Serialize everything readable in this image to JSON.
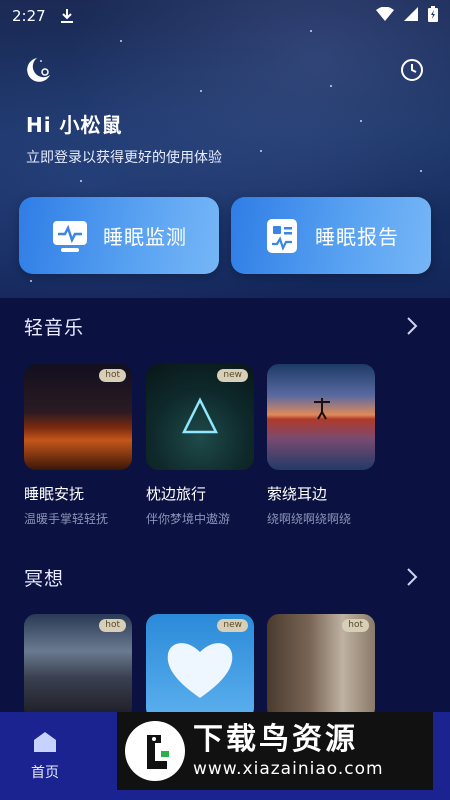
{
  "status_bar": {
    "time": "2:27"
  },
  "header": {
    "greeting": "Hi 小松鼠",
    "subtitle": "立即登录以获得更好的使用体验"
  },
  "actions": [
    {
      "label": "睡眠监测",
      "icon": "monitor-icon"
    },
    {
      "label": "睡眠报告",
      "icon": "report-icon"
    }
  ],
  "sections": [
    {
      "title": "轻音乐",
      "items": [
        {
          "badge": "hot",
          "title": "睡眠安抚",
          "subtitle": "温暖手掌轻轻抚"
        },
        {
          "badge": "new",
          "title": "枕边旅行",
          "subtitle": "伴你梦境中遨游"
        },
        {
          "badge": "",
          "title": "萦绕耳边",
          "subtitle": "绕啊绕啊绕啊绕"
        }
      ]
    },
    {
      "title": "冥想",
      "items": [
        {
          "badge": "hot"
        },
        {
          "badge": "new"
        },
        {
          "badge": "hot"
        }
      ]
    }
  ],
  "tabbar": {
    "home_label": "首页"
  },
  "watermark": {
    "name": "下载鸟资源",
    "url": "www.xiazainiao.com"
  },
  "colors": {
    "background": "#0b1140",
    "accent": "#4a92ee",
    "tabbar": "#1a2390"
  }
}
